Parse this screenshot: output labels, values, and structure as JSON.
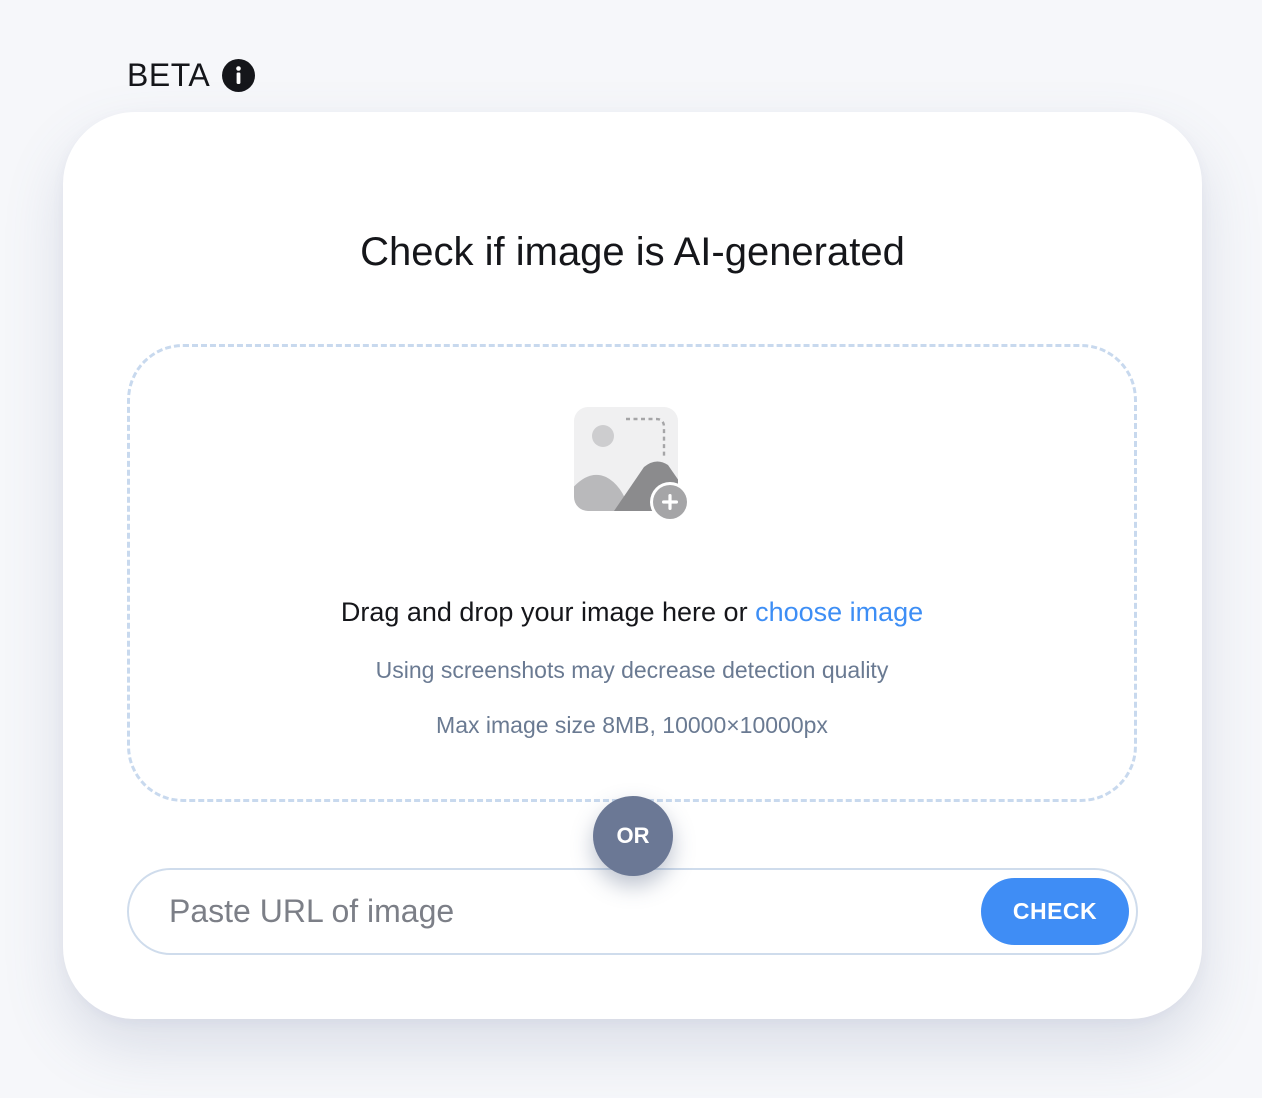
{
  "header": {
    "beta_label": "BETA",
    "info_icon": "info-icon"
  },
  "card": {
    "title": "Check if image is AI-generated",
    "dropzone": {
      "icon": "image-add-icon",
      "drop_text": "Drag and drop your image here or ",
      "choose_link": "choose image",
      "hint_quality": "Using screenshots may decrease detection quality",
      "hint_limits": "Max image size 8MB, 10000×10000px"
    },
    "separator": "OR",
    "url_form": {
      "placeholder": "Paste URL of image",
      "value": "",
      "button_label": "CHECK"
    }
  },
  "colors": {
    "accent": "#3f8df5",
    "link": "#3d8ef5",
    "or_badge": "#6b7895",
    "hint_text": "#6a7a92",
    "dashed_border": "#c8d9ee"
  }
}
